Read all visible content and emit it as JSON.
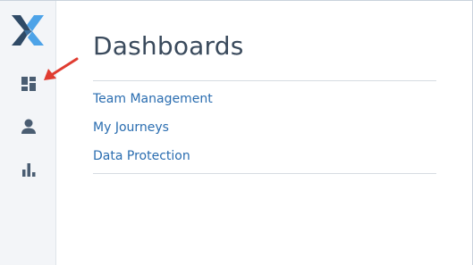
{
  "sidebar": {
    "logo_icon": "brand-x-logo",
    "items": [
      {
        "icon": "dashboard-icon",
        "name": "dashboards"
      },
      {
        "icon": "user-icon",
        "name": "profile"
      },
      {
        "icon": "bar-chart-icon",
        "name": "reports"
      }
    ]
  },
  "main": {
    "title": "Dashboards",
    "links": [
      "Team Management",
      "My Journeys",
      "Data Protection"
    ]
  },
  "colors": {
    "sidebar_bg": "#f3f5f8",
    "icon": "#4a5d72",
    "link": "#2a6db0",
    "title": "#3a4a5c",
    "annotation_arrow": "#e03c31",
    "logo_dark": "#2f4a66",
    "logo_light": "#4da3e8"
  }
}
